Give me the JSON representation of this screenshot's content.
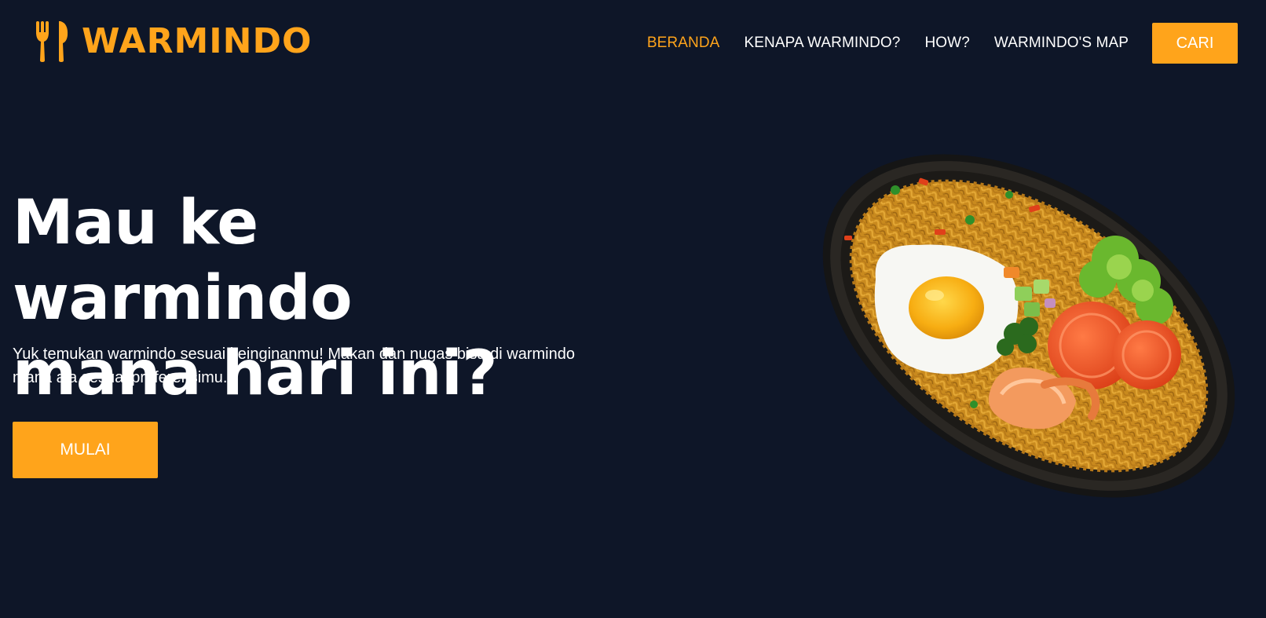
{
  "header": {
    "logo_text": "WARMINDO",
    "logo_icon": "fork-spoon-icon",
    "nav": {
      "items": [
        {
          "label": "BERANDA",
          "active": true
        },
        {
          "label": "KENAPA WARMINDO?",
          "active": false
        },
        {
          "label": "HOW?",
          "active": false
        },
        {
          "label": "WARMINDO'S MAP",
          "active": false
        }
      ],
      "cta_label": "CARI"
    }
  },
  "hero": {
    "title_line1": "Mau ke warmindo",
    "title_line2": "mana hari ini?",
    "subtitle_line1": "Yuk temukan warmindo sesuai keinginanmu! Makan dan nugas bisa di warmindo",
    "subtitle_line2": "mana aja sesuai preferensimu.",
    "button_label": "MULAI",
    "image": "fried-noodle-plate-image"
  },
  "colors": {
    "background": "#0e1628",
    "accent": "#ffa41b",
    "text": "#ffffff"
  }
}
